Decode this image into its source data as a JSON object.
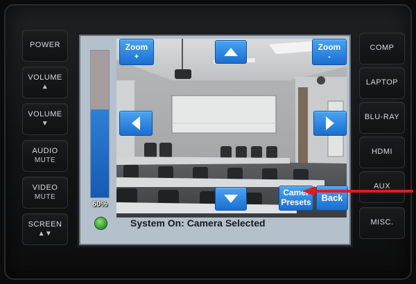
{
  "hardware_buttons": {
    "left": [
      {
        "label": "POWER",
        "sub": ""
      },
      {
        "label": "VOLUME",
        "sub": "▲"
      },
      {
        "label": "VOLUME",
        "sub": "▼"
      },
      {
        "label": "AUDIO",
        "sub": "MUTE"
      },
      {
        "label": "VIDEO",
        "sub": "MUTE"
      },
      {
        "label": "SCREEN",
        "sub": "▲▼"
      }
    ],
    "right": [
      {
        "label": "COMP"
      },
      {
        "label": "LAPTOP"
      },
      {
        "label": "BLU-RAY"
      },
      {
        "label": "HDMI"
      },
      {
        "label": "AUX"
      },
      {
        "label": "MISC."
      }
    ]
  },
  "touch_panel": {
    "zoom_in": {
      "line1": "Zoom",
      "line2": "+"
    },
    "zoom_out": {
      "line1": "Zoom",
      "line2": "-"
    },
    "camera_presets": {
      "line1": "Camer",
      "line2": "Presets"
    },
    "back_label": "Back",
    "pan_up_icon": "arrow-up",
    "pan_down_icon": "arrow-down",
    "pan_left_icon": "arrow-left",
    "pan_right_icon": "arrow-right",
    "volume": {
      "level": 0.6,
      "label": "60%"
    },
    "status_text": "System On:  Camera Selected"
  },
  "colors": {
    "button_blue": "#1a6fd0",
    "volume_fill": "#1659b3",
    "annotation_red": "#e21b1b",
    "status_led": "#2e9a2c"
  }
}
